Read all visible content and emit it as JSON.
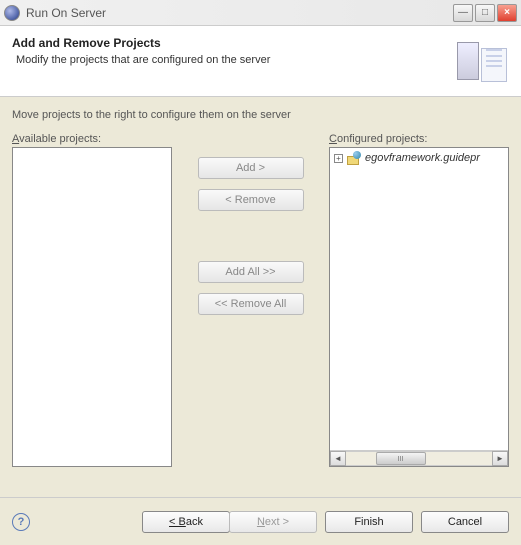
{
  "window": {
    "title": "Run On Server"
  },
  "header": {
    "title": "Add and Remove Projects",
    "subtitle": "Modify the projects that are configured on the server"
  },
  "body": {
    "instruction": "Move projects to the right to configure them on the server",
    "available_label": "Available projects:",
    "configured_label": "Configured projects:"
  },
  "buttons": {
    "add": "Add >",
    "remove": "< Remove",
    "add_all": "Add All >>",
    "remove_all": "<< Remove All"
  },
  "configured_projects": [
    {
      "name": "egovframework.guidepr"
    }
  ],
  "footer": {
    "back": "< Back",
    "next": "Next >",
    "finish": "Finish",
    "cancel": "Cancel"
  }
}
